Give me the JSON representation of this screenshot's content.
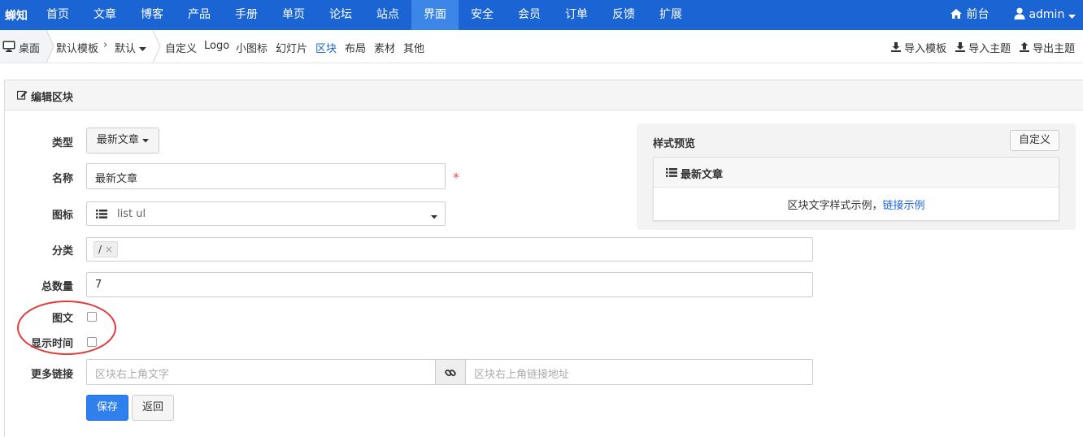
{
  "brand": "蝉知",
  "nav": {
    "items": [
      "首页",
      "文章",
      "博客",
      "产品",
      "手册",
      "单页",
      "论坛",
      "站点",
      "界面",
      "安全",
      "会员",
      "订单",
      "反馈",
      "扩展"
    ],
    "active": "界面",
    "frontend_label": "前台",
    "user_label": "admin",
    "icons": {
      "home": "home-icon",
      "user": "user-icon",
      "caret": "caret-down-icon"
    }
  },
  "crumbs": {
    "home": "桌面",
    "template": "默认模板",
    "theme": "默认",
    "tabs": [
      "自定义",
      "Logo",
      "小图标",
      "幻灯片",
      "区块",
      "布局",
      "素材",
      "其他"
    ],
    "active_tab": "区块",
    "import_template": "导入模板",
    "import_theme": "导入主题",
    "export_theme": "导出主题"
  },
  "panel": {
    "title": "编辑区块"
  },
  "form": {
    "type_label": "类型",
    "type_value": "最新文章",
    "name_label": "名称",
    "name_value": "最新文章",
    "icon_label": "图标",
    "icon_value": "list ul",
    "category_label": "分类",
    "category_tag": "/",
    "total_label": "总数量",
    "total_value": "7",
    "image_text_label": "图文",
    "show_time_label": "显示时间",
    "more_link_label": "更多链接",
    "more_text_placeholder": "区块右上角文字",
    "more_url_placeholder": "区块右上角链接地址",
    "save_label": "保存",
    "back_label": "返回"
  },
  "preview": {
    "title": "样式预览",
    "custom_label": "自定义",
    "box_title": "最新文章",
    "body_text": "区块文字样式示例，",
    "body_link": "链接示例"
  },
  "colors": {
    "nav_bg": "#1a64d4",
    "nav_active": "#3c86e8",
    "primary": "#2f80ed",
    "required": "#d9534f",
    "annotation_circle": "#e23b3b"
  }
}
